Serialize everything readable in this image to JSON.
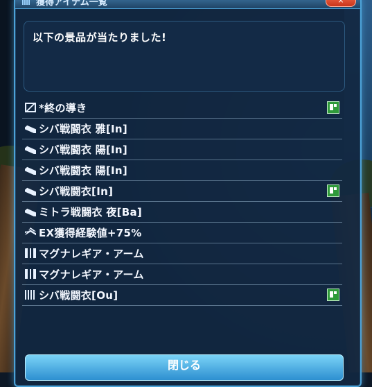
{
  "window": {
    "title": "獲得アイテム一覧",
    "close_top": "×"
  },
  "message": "以下の景品が当たりました!",
  "items": [
    {
      "label": "*終の導き",
      "icon": "box-icon",
      "flag": true
    },
    {
      "label": "シバ戦闘衣 雅[In]",
      "icon": "weapon-icon",
      "flag": false
    },
    {
      "label": "シバ戦闘衣 陽[In]",
      "icon": "weapon-icon",
      "flag": false
    },
    {
      "label": "シバ戦闘衣 陽[In]",
      "icon": "weapon-icon",
      "flag": false
    },
    {
      "label": "シバ戦闘衣[In]",
      "icon": "weapon-icon",
      "flag": true
    },
    {
      "label": "ミトラ戦闘衣 夜[Ba]",
      "icon": "weapon-icon",
      "flag": false
    },
    {
      "label": "EX獲得経験値+75%",
      "icon": "ex-icon",
      "flag": false
    },
    {
      "label": "マグナレギア・アーム",
      "icon": "unit-icon",
      "flag": false
    },
    {
      "label": "マグナレギア・アーム",
      "icon": "unit-icon",
      "flag": false
    },
    {
      "label": "シバ戦闘衣[Ou]",
      "icon": "costume-icon",
      "flag": true
    }
  ],
  "close_button": "閉じる",
  "colors": {
    "window_border": "#4da3d8",
    "close_button": "#2d8fd0",
    "flag": "#2f9a3a"
  }
}
